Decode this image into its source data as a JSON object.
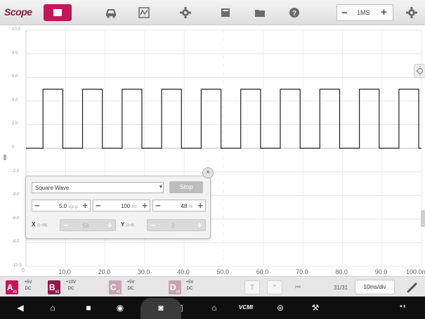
{
  "app": {
    "title": "Scope"
  },
  "toolbar": {
    "buttons": [
      "stop-icon",
      "car-icon",
      "waveform-library-icon",
      "gear-icon",
      "display-icon",
      "folder-icon",
      "help-icon"
    ],
    "samples": {
      "value": "1MS",
      "minus": "−",
      "plus": "+"
    },
    "settings_icon": "gear-icon"
  },
  "plot": {
    "y_ticks": [
      "10.0",
      "8.0",
      "6.0",
      "4.0",
      "2.0",
      "0",
      "-2.0",
      "-4.0",
      "-6.0",
      "-8.0",
      "-10.0"
    ],
    "x_ticks": [
      "0",
      "10.0",
      "20.0",
      "30.0",
      "40.0",
      "50.0",
      "60.0",
      "70.0",
      "80.0",
      "90.0",
      "100.0ms"
    ],
    "trigger_marker": "⇟"
  },
  "chart_data": {
    "type": "line",
    "title": "",
    "xlabel": "",
    "ylabel": "",
    "xlim": [
      0,
      100
    ],
    "ylim": [
      -10,
      10
    ],
    "grid": true,
    "series": [
      {
        "color": "#1f1f1f",
        "waveform": "square",
        "low": 0,
        "high": 5.0,
        "period_ms": 10,
        "x": [
          0,
          4.3,
          4.3,
          9.3,
          9.3,
          14.3,
          14.3,
          19.3,
          19.3,
          24.3,
          24.3,
          29.3,
          29.3,
          34.3,
          34.3,
          39.3,
          39.3,
          44.3,
          44.3,
          49.3,
          49.3,
          54.3,
          54.3,
          59.3,
          59.3,
          64.3,
          64.3,
          69.3,
          69.3,
          74.3,
          74.3,
          79.3,
          79.3,
          84.3,
          84.3,
          89.3,
          89.3,
          94.3,
          94.3,
          99.3,
          99.3,
          100
        ],
        "y": [
          0,
          0,
          5.0,
          5.0,
          0,
          0,
          5.0,
          5.0,
          0,
          0,
          5.0,
          5.0,
          0,
          0,
          5.0,
          5.0,
          0,
          0,
          5.0,
          5.0,
          0,
          0,
          5.0,
          5.0,
          0,
          0,
          5.0,
          5.0,
          0,
          0,
          5.0,
          5.0,
          0,
          0,
          5.0,
          5.0,
          0,
          0,
          5.0,
          5.0,
          0,
          0
        ]
      }
    ]
  },
  "generator": {
    "waveform": "Square Wave",
    "stop_label": "Stop",
    "amplitude": {
      "value": "5.0",
      "unit": "Vp-p"
    },
    "frequency": {
      "value": "100",
      "unit": "Hz"
    },
    "duty": {
      "value": "48",
      "unit": "%"
    },
    "x": {
      "label": "X",
      "range": "(1~99)",
      "value": "58"
    },
    "y": {
      "label": "Y",
      "range": "(1~9)",
      "value": "2"
    },
    "close": "×"
  },
  "channels": [
    {
      "letter": "A",
      "sub": "x1",
      "color": "#c2185b",
      "volt": "+5V",
      "coupling": "DC"
    },
    {
      "letter": "B",
      "sub": "x1",
      "color": "#8e1a4a",
      "volt": "+10V",
      "coupling": "DC"
    },
    {
      "letter": "C",
      "sub": "x1",
      "color": "#c9a2b5",
      "volt": "+5V",
      "coupling": "DC"
    },
    {
      "letter": "D",
      "sub": "x1",
      "color": "#c9a2b5",
      "volt": "+5V",
      "coupling": "DC"
    }
  ],
  "bottom_controls": {
    "trigger": "T",
    "edge": "⌃",
    "first": "⏮",
    "page": "31/31",
    "last": "⏭",
    "timebase": "10ms/div",
    "probe_icon": "probe-icon"
  },
  "navbar": {
    "icons": [
      "back-icon",
      "home-icon",
      "recent-apps-icon",
      "chrome-icon",
      "camera-icon",
      "screen-record-icon",
      "garage-icon",
      "vcmi-icon",
      "car-icon",
      "mechanic-icon"
    ],
    "vcmi_label": "VCMI"
  }
}
